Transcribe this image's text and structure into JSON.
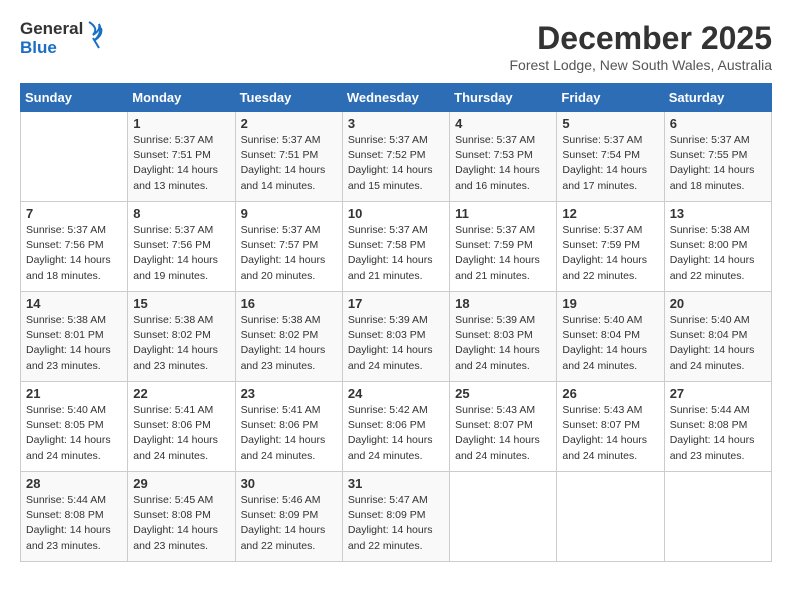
{
  "logo": {
    "line1": "General",
    "line2": "Blue"
  },
  "title": {
    "month_year": "December 2025",
    "location": "Forest Lodge, New South Wales, Australia"
  },
  "days_of_week": [
    "Sunday",
    "Monday",
    "Tuesday",
    "Wednesday",
    "Thursday",
    "Friday",
    "Saturday"
  ],
  "weeks": [
    [
      {
        "day": "",
        "info": ""
      },
      {
        "day": "1",
        "info": "Sunrise: 5:37 AM\nSunset: 7:51 PM\nDaylight: 14 hours\nand 13 minutes."
      },
      {
        "day": "2",
        "info": "Sunrise: 5:37 AM\nSunset: 7:51 PM\nDaylight: 14 hours\nand 14 minutes."
      },
      {
        "day": "3",
        "info": "Sunrise: 5:37 AM\nSunset: 7:52 PM\nDaylight: 14 hours\nand 15 minutes."
      },
      {
        "day": "4",
        "info": "Sunrise: 5:37 AM\nSunset: 7:53 PM\nDaylight: 14 hours\nand 16 minutes."
      },
      {
        "day": "5",
        "info": "Sunrise: 5:37 AM\nSunset: 7:54 PM\nDaylight: 14 hours\nand 17 minutes."
      },
      {
        "day": "6",
        "info": "Sunrise: 5:37 AM\nSunset: 7:55 PM\nDaylight: 14 hours\nand 18 minutes."
      }
    ],
    [
      {
        "day": "7",
        "info": "Sunrise: 5:37 AM\nSunset: 7:56 PM\nDaylight: 14 hours\nand 18 minutes."
      },
      {
        "day": "8",
        "info": "Sunrise: 5:37 AM\nSunset: 7:56 PM\nDaylight: 14 hours\nand 19 minutes."
      },
      {
        "day": "9",
        "info": "Sunrise: 5:37 AM\nSunset: 7:57 PM\nDaylight: 14 hours\nand 20 minutes."
      },
      {
        "day": "10",
        "info": "Sunrise: 5:37 AM\nSunset: 7:58 PM\nDaylight: 14 hours\nand 21 minutes."
      },
      {
        "day": "11",
        "info": "Sunrise: 5:37 AM\nSunset: 7:59 PM\nDaylight: 14 hours\nand 21 minutes."
      },
      {
        "day": "12",
        "info": "Sunrise: 5:37 AM\nSunset: 7:59 PM\nDaylight: 14 hours\nand 22 minutes."
      },
      {
        "day": "13",
        "info": "Sunrise: 5:38 AM\nSunset: 8:00 PM\nDaylight: 14 hours\nand 22 minutes."
      }
    ],
    [
      {
        "day": "14",
        "info": "Sunrise: 5:38 AM\nSunset: 8:01 PM\nDaylight: 14 hours\nand 23 minutes."
      },
      {
        "day": "15",
        "info": "Sunrise: 5:38 AM\nSunset: 8:02 PM\nDaylight: 14 hours\nand 23 minutes."
      },
      {
        "day": "16",
        "info": "Sunrise: 5:38 AM\nSunset: 8:02 PM\nDaylight: 14 hours\nand 23 minutes."
      },
      {
        "day": "17",
        "info": "Sunrise: 5:39 AM\nSunset: 8:03 PM\nDaylight: 14 hours\nand 24 minutes."
      },
      {
        "day": "18",
        "info": "Sunrise: 5:39 AM\nSunset: 8:03 PM\nDaylight: 14 hours\nand 24 minutes."
      },
      {
        "day": "19",
        "info": "Sunrise: 5:40 AM\nSunset: 8:04 PM\nDaylight: 14 hours\nand 24 minutes."
      },
      {
        "day": "20",
        "info": "Sunrise: 5:40 AM\nSunset: 8:04 PM\nDaylight: 14 hours\nand 24 minutes."
      }
    ],
    [
      {
        "day": "21",
        "info": "Sunrise: 5:40 AM\nSunset: 8:05 PM\nDaylight: 14 hours\nand 24 minutes."
      },
      {
        "day": "22",
        "info": "Sunrise: 5:41 AM\nSunset: 8:06 PM\nDaylight: 14 hours\nand 24 minutes."
      },
      {
        "day": "23",
        "info": "Sunrise: 5:41 AM\nSunset: 8:06 PM\nDaylight: 14 hours\nand 24 minutes."
      },
      {
        "day": "24",
        "info": "Sunrise: 5:42 AM\nSunset: 8:06 PM\nDaylight: 14 hours\nand 24 minutes."
      },
      {
        "day": "25",
        "info": "Sunrise: 5:43 AM\nSunset: 8:07 PM\nDaylight: 14 hours\nand 24 minutes."
      },
      {
        "day": "26",
        "info": "Sunrise: 5:43 AM\nSunset: 8:07 PM\nDaylight: 14 hours\nand 24 minutes."
      },
      {
        "day": "27",
        "info": "Sunrise: 5:44 AM\nSunset: 8:08 PM\nDaylight: 14 hours\nand 23 minutes."
      }
    ],
    [
      {
        "day": "28",
        "info": "Sunrise: 5:44 AM\nSunset: 8:08 PM\nDaylight: 14 hours\nand 23 minutes."
      },
      {
        "day": "29",
        "info": "Sunrise: 5:45 AM\nSunset: 8:08 PM\nDaylight: 14 hours\nand 23 minutes."
      },
      {
        "day": "30",
        "info": "Sunrise: 5:46 AM\nSunset: 8:09 PM\nDaylight: 14 hours\nand 22 minutes."
      },
      {
        "day": "31",
        "info": "Sunrise: 5:47 AM\nSunset: 8:09 PM\nDaylight: 14 hours\nand 22 minutes."
      },
      {
        "day": "",
        "info": ""
      },
      {
        "day": "",
        "info": ""
      },
      {
        "day": "",
        "info": ""
      }
    ]
  ]
}
